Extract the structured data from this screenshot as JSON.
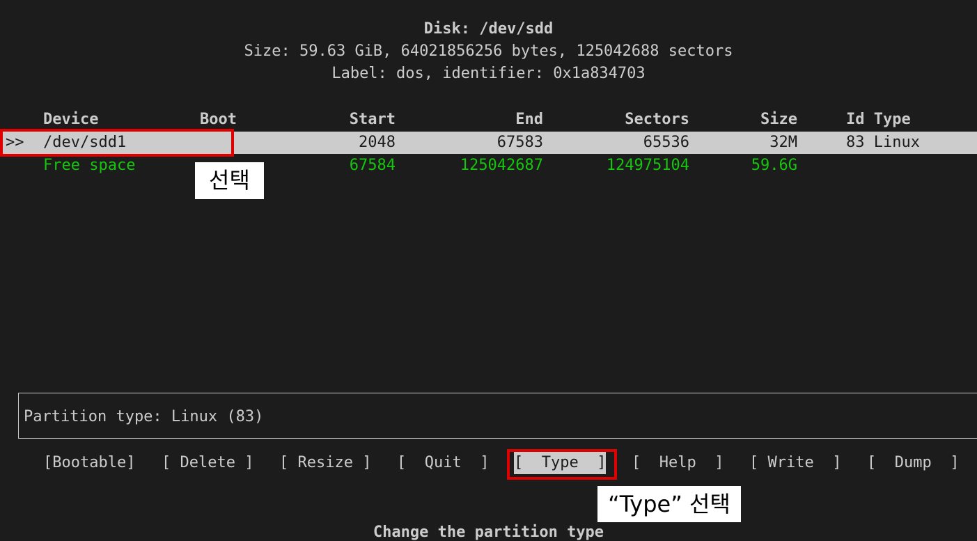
{
  "disk": {
    "title": "Disk: /dev/sdd",
    "size_line": "Size: 59.63 GiB, 64021856256 bytes, 125042688 sectors",
    "label_line": "Label: dos, identifier: 0x1a834703"
  },
  "table": {
    "headers": {
      "device": "Device",
      "boot": "Boot",
      "start": "Start",
      "end": "End",
      "sectors": "Sectors",
      "size": "Size",
      "idtype": "Id Type"
    },
    "rows": [
      {
        "cursor": ">>",
        "device": "/dev/sdd1",
        "boot": "",
        "start": "2048",
        "end": "67583",
        "sectors": "65536",
        "size": "32M",
        "idtype": "83 Linux"
      },
      {
        "cursor": "",
        "device": "Free space",
        "boot": "",
        "start": "67584",
        "end": "125042687",
        "sectors": "124975104",
        "size": "59.6G",
        "idtype": ""
      }
    ]
  },
  "info": {
    "partition_type": "Partition type: Linux (83)"
  },
  "menu": {
    "items": [
      {
        "label": "[Bootable]"
      },
      {
        "label": "[ Delete ]"
      },
      {
        "label": "[ Resize ]"
      },
      {
        "label": "[  Quit  ]"
      },
      {
        "label": "[  Type  ]",
        "active": true
      },
      {
        "label": "[  Help  ]"
      },
      {
        "label": "[ Write  ]"
      },
      {
        "label": "[  Dump  ]"
      }
    ]
  },
  "status": {
    "hint": "Change the partition type"
  },
  "annotations": {
    "select_label": "선택",
    "type_select_label": "“Type” 선택"
  },
  "colors": {
    "background": "#1c1c1c",
    "foreground": "#cccccc",
    "free_space": "#16c60c",
    "highlight_box": "#e00000"
  }
}
